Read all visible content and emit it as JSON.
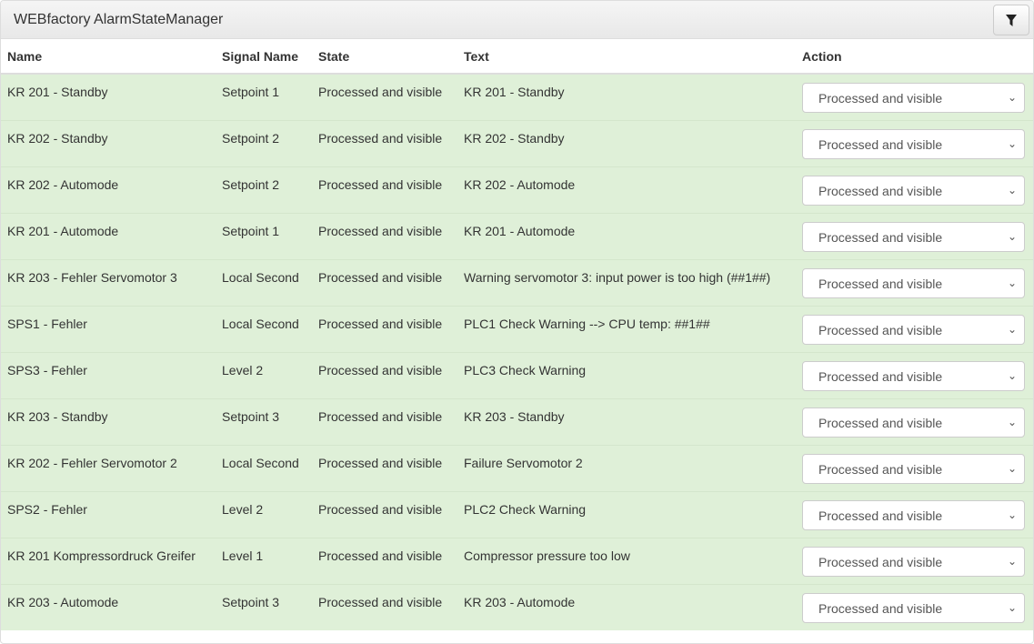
{
  "header": {
    "title": "WEBfactory AlarmStateManager",
    "filter_icon": "filter-icon"
  },
  "columns": [
    "Name",
    "Signal Name",
    "State",
    "Text",
    "Action"
  ],
  "rows": [
    {
      "name": "KR 201 - Standby",
      "signal": "Setpoint 1",
      "state": "Processed and visible",
      "text": "KR 201 - Standby",
      "action": "Processed and visible"
    },
    {
      "name": "KR 202 - Standby",
      "signal": "Setpoint 2",
      "state": "Processed and visible",
      "text": "KR 202 - Standby",
      "action": "Processed and visible"
    },
    {
      "name": "KR 202 - Automode",
      "signal": "Setpoint 2",
      "state": "Processed and visible",
      "text": "KR 202 - Automode",
      "action": "Processed and visible"
    },
    {
      "name": "KR 201 - Automode",
      "signal": "Setpoint 1",
      "state": "Processed and visible",
      "text": "KR 201 - Automode",
      "action": "Processed and visible"
    },
    {
      "name": "KR 203 - Fehler Servomotor 3",
      "signal": "Local Second",
      "state": "Processed and visible",
      "text": "Warning servomotor 3: input power is too high (##1##)",
      "action": "Processed and visible"
    },
    {
      "name": "SPS1 - Fehler",
      "signal": "Local Second",
      "state": "Processed and visible",
      "text": "PLC1 Check Warning --> CPU temp: ##1##",
      "action": "Processed and visible"
    },
    {
      "name": "SPS3 - Fehler",
      "signal": "Level 2",
      "state": "Processed and visible",
      "text": "PLC3 Check Warning",
      "action": "Processed and visible"
    },
    {
      "name": "KR 203 - Standby",
      "signal": "Setpoint 3",
      "state": "Processed and visible",
      "text": "KR 203 - Standby",
      "action": "Processed and visible"
    },
    {
      "name": "KR 202 - Fehler Servomotor 2",
      "signal": "Local Second",
      "state": "Processed and visible",
      "text": "Failure Servomotor 2",
      "action": "Processed and visible"
    },
    {
      "name": "SPS2 - Fehler",
      "signal": "Level 2",
      "state": "Processed and visible",
      "text": "PLC2 Check Warning",
      "action": "Processed and visible"
    },
    {
      "name": "KR 201 Kompressordruck Greifer",
      "signal": "Level 1",
      "state": "Processed and visible",
      "text": "Compressor pressure too low",
      "action": "Processed and visible"
    },
    {
      "name": "KR 203 - Automode",
      "signal": "Setpoint 3",
      "state": "Processed and visible",
      "text": "KR 203 - Automode",
      "action": "Processed and visible"
    }
  ],
  "colors": {
    "row_success": "#dff0d8"
  }
}
